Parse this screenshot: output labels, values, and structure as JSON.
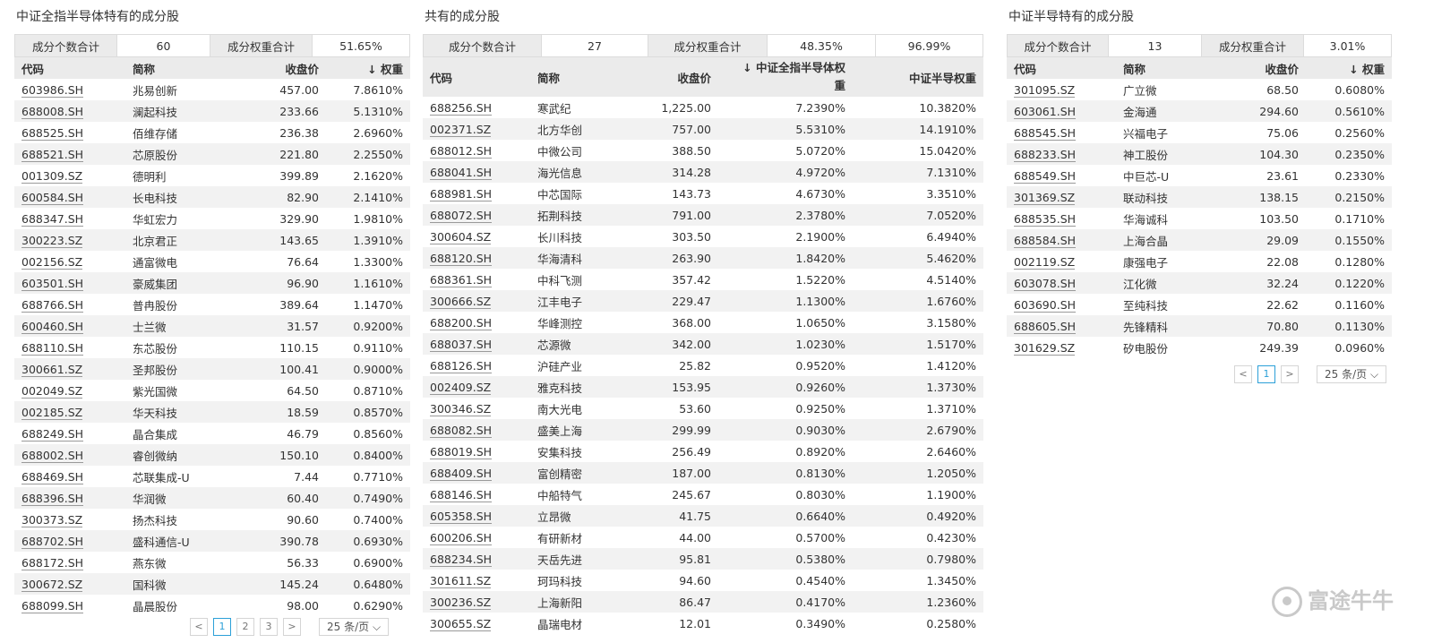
{
  "watermark": "富途牛牛",
  "left": {
    "title": "中证全指半导体特有的成分股",
    "summary": {
      "count_label": "成分个数合计",
      "count": "60",
      "weight_label": "成分权重合计",
      "weight": "51.65%"
    },
    "headers": {
      "code": "代码",
      "name": "简称",
      "price": "收盘价",
      "weight": "↓ 权重"
    },
    "rows": [
      [
        "603986.SH",
        "兆易创新",
        "457.00",
        "7.8610%"
      ],
      [
        "688008.SH",
        "澜起科技",
        "233.66",
        "5.1310%"
      ],
      [
        "688525.SH",
        "佰维存储",
        "236.38",
        "2.6960%"
      ],
      [
        "688521.SH",
        "芯原股份",
        "221.80",
        "2.2550%"
      ],
      [
        "001309.SZ",
        "德明利",
        "399.89",
        "2.1620%"
      ],
      [
        "600584.SH",
        "长电科技",
        "82.90",
        "2.1410%"
      ],
      [
        "688347.SH",
        "华虹宏力",
        "329.90",
        "1.9810%"
      ],
      [
        "300223.SZ",
        "北京君正",
        "143.65",
        "1.3910%"
      ],
      [
        "002156.SZ",
        "通富微电",
        "76.64",
        "1.3300%"
      ],
      [
        "603501.SH",
        "豪威集团",
        "96.90",
        "1.1610%"
      ],
      [
        "688766.SH",
        "普冉股份",
        "389.64",
        "1.1470%"
      ],
      [
        "600460.SH",
        "士兰微",
        "31.57",
        "0.9200%"
      ],
      [
        "688110.SH",
        "东芯股份",
        "110.15",
        "0.9110%"
      ],
      [
        "300661.SZ",
        "圣邦股份",
        "100.41",
        "0.9000%"
      ],
      [
        "002049.SZ",
        "紫光国微",
        "64.50",
        "0.8710%"
      ],
      [
        "002185.SZ",
        "华天科技",
        "18.59",
        "0.8570%"
      ],
      [
        "688249.SH",
        "晶合集成",
        "46.79",
        "0.8560%"
      ],
      [
        "688002.SH",
        "睿创微纳",
        "150.10",
        "0.8400%"
      ],
      [
        "688469.SH",
        "芯联集成-U",
        "7.44",
        "0.7710%"
      ],
      [
        "688396.SH",
        "华润微",
        "60.40",
        "0.7490%"
      ],
      [
        "300373.SZ",
        "扬杰科技",
        "90.60",
        "0.7400%"
      ],
      [
        "688702.SH",
        "盛科通信-U",
        "390.78",
        "0.6930%"
      ],
      [
        "688172.SH",
        "燕东微",
        "56.33",
        "0.6900%"
      ],
      [
        "300672.SZ",
        "国科微",
        "145.24",
        "0.6480%"
      ],
      [
        "688099.SH",
        "晶晨股份",
        "98.00",
        "0.6290%"
      ]
    ],
    "pager": {
      "prev": "<",
      "pages": [
        "1",
        "2",
        "3"
      ],
      "next": ">",
      "size": "25 条/页 ⌵"
    }
  },
  "middle": {
    "title": "共有的成分股",
    "summary": {
      "count_label": "成分个数合计",
      "count": "27",
      "weight_label": "成分权重合计",
      "weight1": "48.35%",
      "weight2": "96.99%"
    },
    "headers": {
      "code": "代码",
      "name": "简称",
      "price": "收盘价",
      "weight1_line1": "↓ 中证全指半导体权",
      "weight1_line2": "重",
      "weight2": "中证半导权重"
    },
    "rows": [
      [
        "688256.SH",
        "寒武纪",
        "1,225.00",
        "7.2390%",
        "10.3820%"
      ],
      [
        "002371.SZ",
        "北方华创",
        "757.00",
        "5.5310%",
        "14.1910%"
      ],
      [
        "688012.SH",
        "中微公司",
        "388.50",
        "5.0720%",
        "15.0420%"
      ],
      [
        "688041.SH",
        "海光信息",
        "314.28",
        "4.9720%",
        "7.1310%"
      ],
      [
        "688981.SH",
        "中芯国际",
        "143.73",
        "4.6730%",
        "3.3510%"
      ],
      [
        "688072.SH",
        "拓荆科技",
        "791.00",
        "2.3780%",
        "7.0520%"
      ],
      [
        "300604.SZ",
        "长川科技",
        "303.50",
        "2.1900%",
        "6.4940%"
      ],
      [
        "688120.SH",
        "华海清科",
        "263.90",
        "1.8420%",
        "5.4620%"
      ],
      [
        "688361.SH",
        "中科飞测",
        "357.42",
        "1.5220%",
        "4.5140%"
      ],
      [
        "300666.SZ",
        "江丰电子",
        "229.47",
        "1.1300%",
        "1.6760%"
      ],
      [
        "688200.SH",
        "华峰测控",
        "368.00",
        "1.0650%",
        "3.1580%"
      ],
      [
        "688037.SH",
        "芯源微",
        "342.00",
        "1.0230%",
        "1.5170%"
      ],
      [
        "688126.SH",
        "沪硅产业",
        "25.82",
        "0.9520%",
        "1.4120%"
      ],
      [
        "002409.SZ",
        "雅克科技",
        "153.95",
        "0.9260%",
        "1.3730%"
      ],
      [
        "300346.SZ",
        "南大光电",
        "53.60",
        "0.9250%",
        "1.3710%"
      ],
      [
        "688082.SH",
        "盛美上海",
        "299.99",
        "0.9030%",
        "2.6790%"
      ],
      [
        "688019.SH",
        "安集科技",
        "256.49",
        "0.8920%",
        "2.6460%"
      ],
      [
        "688409.SH",
        "富创精密",
        "187.00",
        "0.8130%",
        "1.2050%"
      ],
      [
        "688146.SH",
        "中船特气",
        "245.67",
        "0.8030%",
        "1.1900%"
      ],
      [
        "605358.SH",
        "立昂微",
        "41.75",
        "0.6640%",
        "0.4920%"
      ],
      [
        "600206.SH",
        "有研新材",
        "44.00",
        "0.5700%",
        "0.4230%"
      ],
      [
        "688234.SH",
        "天岳先进",
        "95.81",
        "0.5380%",
        "0.7980%"
      ],
      [
        "301611.SZ",
        "珂玛科技",
        "94.60",
        "0.4540%",
        "1.3450%"
      ],
      [
        "300236.SZ",
        "上海新阳",
        "86.47",
        "0.4170%",
        "1.2360%"
      ],
      [
        "300655.SZ",
        "晶瑞电材",
        "12.01",
        "0.3490%",
        "0.2580%"
      ]
    ]
  },
  "right": {
    "title": "中证半导特有的成分股",
    "summary": {
      "count_label": "成分个数合计",
      "count": "13",
      "weight_label": "成分权重合计",
      "weight": "3.01%"
    },
    "headers": {
      "code": "代码",
      "name": "简称",
      "price": "收盘价",
      "weight": "↓ 权重"
    },
    "rows": [
      [
        "301095.SZ",
        "广立微",
        "68.50",
        "0.6080%"
      ],
      [
        "603061.SH",
        "金海通",
        "294.60",
        "0.5610%"
      ],
      [
        "688545.SH",
        "兴福电子",
        "75.06",
        "0.2560%"
      ],
      [
        "688233.SH",
        "神工股份",
        "104.30",
        "0.2350%"
      ],
      [
        "688549.SH",
        "中巨芯-U",
        "23.61",
        "0.2330%"
      ],
      [
        "301369.SZ",
        "联动科技",
        "138.15",
        "0.2150%"
      ],
      [
        "688535.SH",
        "华海诚科",
        "103.50",
        "0.1710%"
      ],
      [
        "688584.SH",
        "上海合晶",
        "29.09",
        "0.1550%"
      ],
      [
        "002119.SZ",
        "康强电子",
        "22.08",
        "0.1280%"
      ],
      [
        "603078.SH",
        "江化微",
        "32.24",
        "0.1220%"
      ],
      [
        "603690.SH",
        "至纯科技",
        "22.62",
        "0.1160%"
      ],
      [
        "688605.SH",
        "先锋精科",
        "70.80",
        "0.1130%"
      ],
      [
        "301629.SZ",
        "矽电股份",
        "249.39",
        "0.0960%"
      ]
    ],
    "pager": {
      "prev": "<",
      "pages": [
        "1"
      ],
      "next": ">",
      "size": "25 条/页 ⌵"
    }
  }
}
